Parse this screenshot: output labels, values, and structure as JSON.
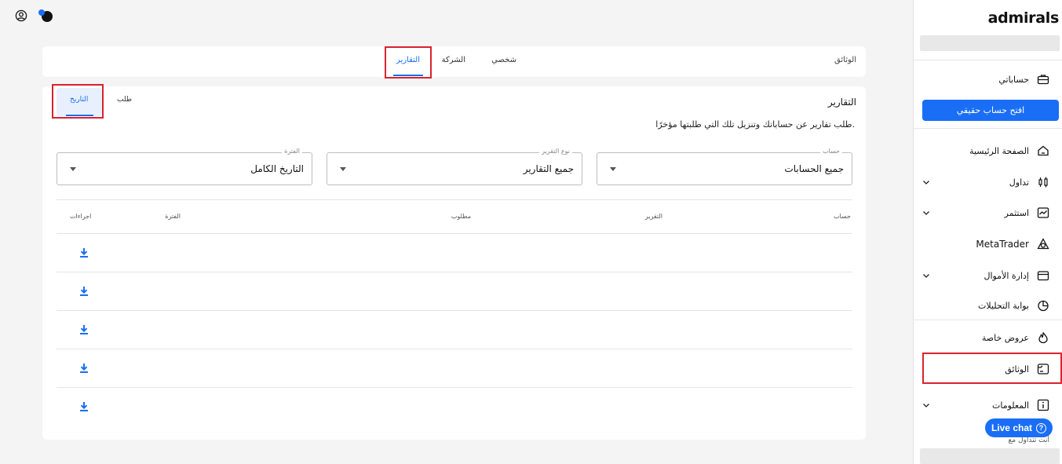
{
  "brand": {
    "logo": "admirals"
  },
  "sidebar": {
    "my_accounts": "حساباتي",
    "open_real_account": "افتح حساب حقيقي",
    "items": [
      {
        "label": "الصفحة الرئيسية",
        "icon": "home-icon",
        "chevron": false
      },
      {
        "label": "تداول",
        "icon": "candlestick-icon",
        "chevron": true
      },
      {
        "label": "استثمر",
        "icon": "chart-icon",
        "chevron": true
      },
      {
        "label": "MetaTrader",
        "icon": "metatrader-icon",
        "chevron": false
      },
      {
        "label": "إدارة الأموال",
        "icon": "wallet-icon",
        "chevron": true
      },
      {
        "label": "بوابة التحليلات",
        "icon": "pie-chart-icon",
        "chevron": false
      },
      {
        "label": "عروض خاصة",
        "icon": "flame-icon",
        "chevron": false
      },
      {
        "label": "الوثائق",
        "icon": "folder-icon",
        "chevron": false
      },
      {
        "label": "المعلومات",
        "icon": "info-icon",
        "chevron": true
      }
    ],
    "live_chat": "Live chat",
    "footer_note": "أنت تتداول مع"
  },
  "tabs_bar": {
    "title": "الوثائق",
    "tabs": [
      "شخصي",
      "الشركة",
      "التقارير"
    ],
    "active": "التقارير"
  },
  "reports": {
    "title": "التقارير",
    "description": "طلب تقارير عن حساباتك وتنزيل تلك التي طلبتها مؤخرًا.",
    "subtabs": [
      "طلب",
      "التاريخ"
    ],
    "active_subtab": "التاريخ",
    "filters": [
      {
        "label": "حساب",
        "value": "جميع الحسابات"
      },
      {
        "label": "نوع التقرير",
        "value": "جميع التقارير"
      },
      {
        "label": "الفترة",
        "value": "التاريخ الكامل"
      }
    ],
    "columns": [
      "حساب",
      "التقرير",
      "مطلوب",
      "الفترة",
      "اجراءات"
    ],
    "row_count": 5
  },
  "colors": {
    "accent": "#1a6ef5",
    "highlight": "#d9232e"
  }
}
